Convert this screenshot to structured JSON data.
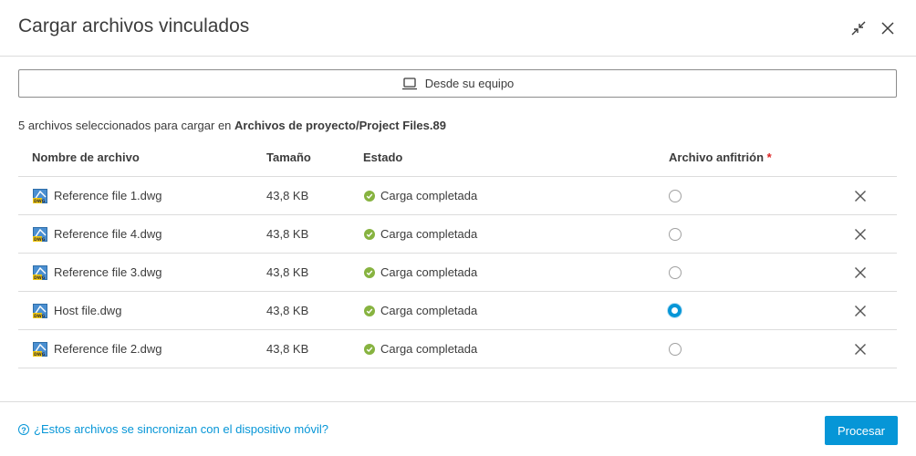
{
  "dialog": {
    "title": "Cargar archivos vinculados",
    "minimize_icon": "collapse-arrows-icon",
    "close_icon": "close-icon"
  },
  "upload_source": {
    "label": "Desde su equipo",
    "icon": "laptop-icon"
  },
  "info": {
    "prefix": "5 archivos seleccionados para cargar en ",
    "destination": "Archivos de proyecto/Project Files.89"
  },
  "table": {
    "headers": {
      "name": "Nombre de archivo",
      "size": "Tamaño",
      "status": "Estado",
      "host": "Archivo anfitrión",
      "required_mark": "*"
    },
    "rows": [
      {
        "name": "Reference file 1.dwg",
        "size": "43,8 KB",
        "status": "Carga completada",
        "host": false
      },
      {
        "name": "Reference file 4.dwg",
        "size": "43,8 KB",
        "status": "Carga completada",
        "host": false
      },
      {
        "name": "Reference file 3.dwg",
        "size": "43,8 KB",
        "status": "Carga completada",
        "host": false
      },
      {
        "name": "Host file.dwg",
        "size": "43,8 KB",
        "status": "Carga completada",
        "host": true
      },
      {
        "name": "Reference file 2.dwg",
        "size": "43,8 KB",
        "status": "Carga completada",
        "host": false
      }
    ]
  },
  "footer": {
    "help_link": "¿Estos archivos se sincronizan con el dispositivo móvil?",
    "process_button": "Procesar"
  },
  "colors": {
    "accent": "#0696d7",
    "success": "#87b340",
    "required": "#dd2222"
  }
}
